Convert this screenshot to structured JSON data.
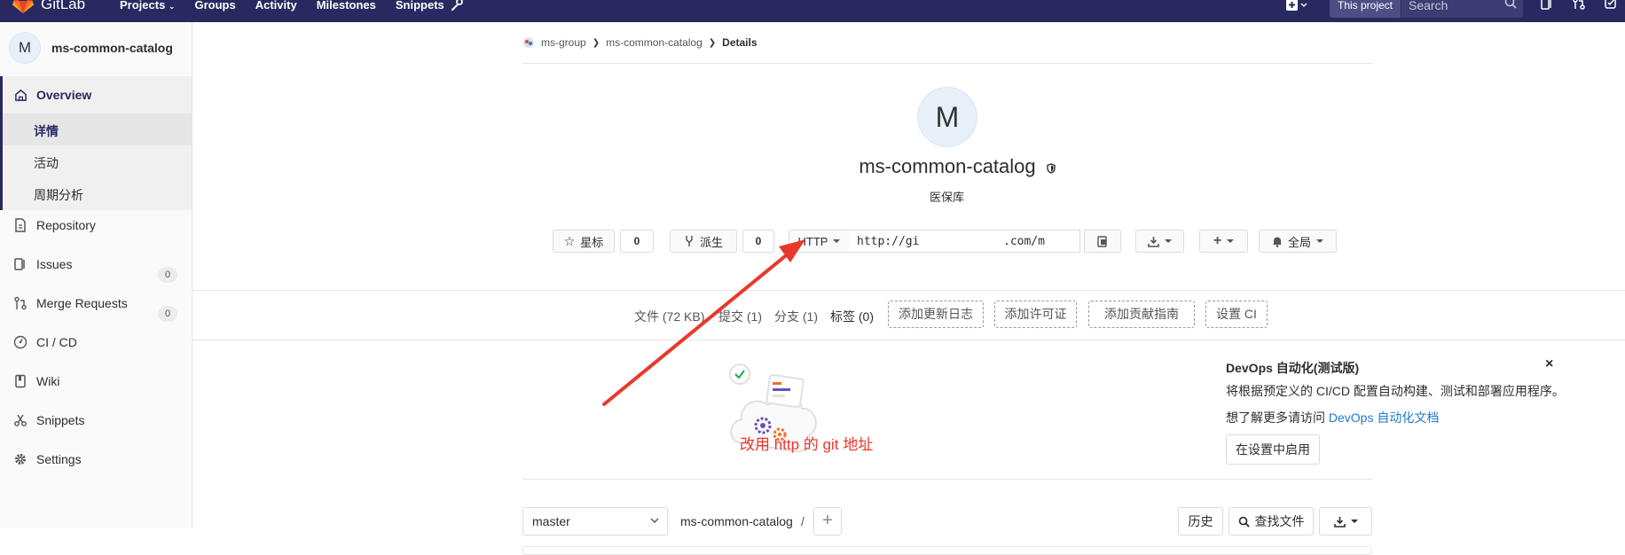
{
  "navbar": {
    "brand": "GitLab",
    "links": [
      "Projects",
      "Groups",
      "Activity",
      "Milestones",
      "Snippets"
    ],
    "scope_label": "This project",
    "search_placeholder": "Search"
  },
  "sidebar": {
    "project_initial": "M",
    "project_name": "ms-common-catalog",
    "overview_label": "Overview",
    "overview_sub": [
      "详情",
      "活动",
      "周期分析"
    ],
    "items": [
      {
        "label": "Repository"
      },
      {
        "label": "Issues",
        "count": "0"
      },
      {
        "label": "Merge Requests",
        "count": "0"
      },
      {
        "label": "CI / CD"
      },
      {
        "label": "Wiki"
      },
      {
        "label": "Snippets"
      },
      {
        "label": "Settings"
      }
    ]
  },
  "breadcrumb": {
    "group": "ms-group",
    "project": "ms-common-catalog",
    "current": "Details"
  },
  "project": {
    "initial": "M",
    "title": "ms-common-catalog",
    "description": "医保库",
    "star_label": "星标",
    "star_count": "0",
    "fork_label": "派生",
    "fork_count": "0",
    "protocol": "HTTP",
    "url_start": "http://gi",
    "url_end": ".com/m",
    "notify_label": "全局"
  },
  "stats": {
    "files": "文件 (72 KB)",
    "commits": "提交 (1)",
    "branches": "分支 (1)",
    "tags": "标签 (0)",
    "add_changelog": "添加更新日志",
    "add_license": "添加许可证",
    "add_contributing": "添加贡献指南",
    "setup_ci": "设置 CI"
  },
  "devops": {
    "title": "DevOps 自动化(测试版)",
    "desc": "将根据预定义的 CI/CD 配置自动构建、测试和部署应用程序。",
    "learn_prefix": "想了解更多请访问 ",
    "learn_link": "DevOps 自动化文档",
    "enable_button": "在设置中启用",
    "close": "×"
  },
  "annotation": {
    "text": "改用 http 的 git 地址",
    "color": "#e8382b"
  },
  "repo_bar": {
    "branch": "master",
    "path": "ms-common-catalog",
    "path_sep": "/",
    "history": "历史",
    "find_file": "查找文件"
  },
  "colors": {
    "navbar": "#292961",
    "accent": "#292961",
    "link": "#1f78d1"
  }
}
